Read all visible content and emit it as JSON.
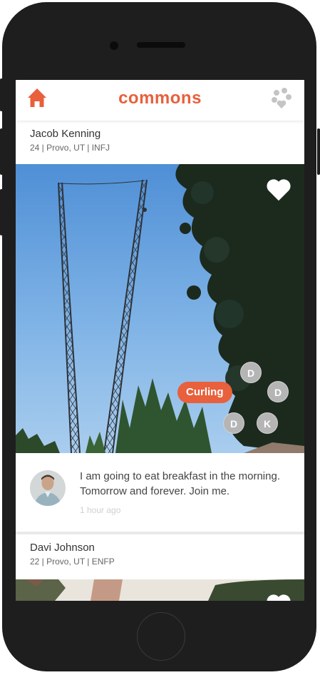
{
  "app": {
    "brand": "commons",
    "accent": "#e8603c"
  },
  "header": {
    "home_icon": "home-icon",
    "groups_icon": "groups-icon"
  },
  "feed": [
    {
      "name": "Jacob Kenning",
      "meta": "24 | Provo, UT | INFJ",
      "photo": "radio towers under blue sky with trees",
      "tag": "Curling",
      "participants": [
        "D",
        "D",
        "D",
        "K"
      ],
      "post": {
        "text": "I am going to eat breakfast in the morning. Tomorrow and forever. Join me.",
        "time": "1 hour ago"
      }
    },
    {
      "name": "Davi Johnson",
      "meta": "22 | Provo, UT | ENFP",
      "photo": "outdoor scene with trees"
    }
  ]
}
